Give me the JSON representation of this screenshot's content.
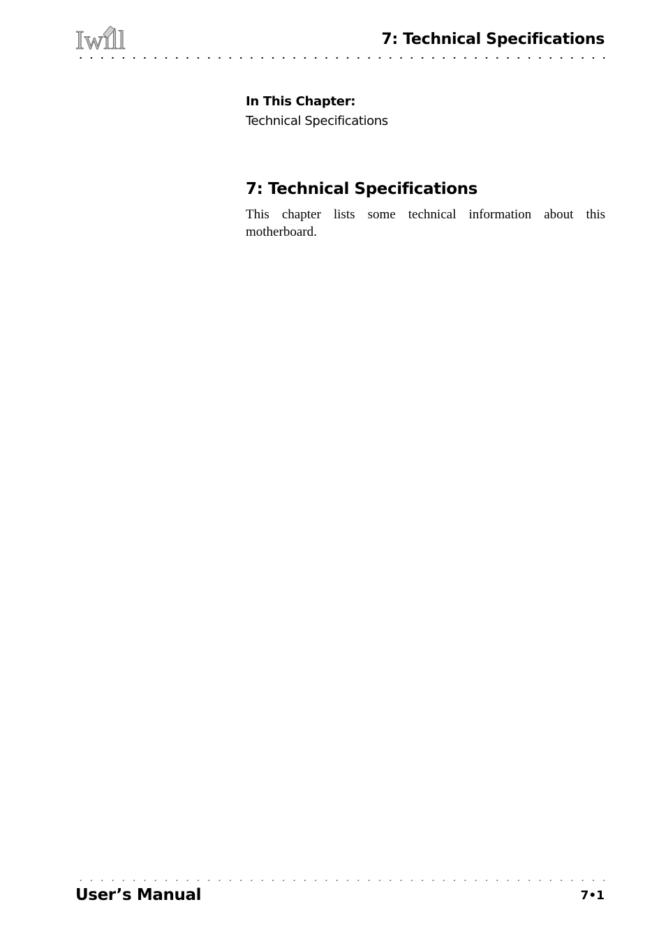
{
  "header": {
    "logo_text": "Iwill",
    "chapter_title": "7: Technical Specifications"
  },
  "in_this_chapter": {
    "label": "In This Chapter:",
    "items": [
      "Technical Specifications"
    ]
  },
  "section": {
    "title": "7: Technical Specifications",
    "body": "This chapter lists some technical information about this motherboard."
  },
  "footer": {
    "title": "User’s Manual",
    "page_number": "7•1"
  }
}
